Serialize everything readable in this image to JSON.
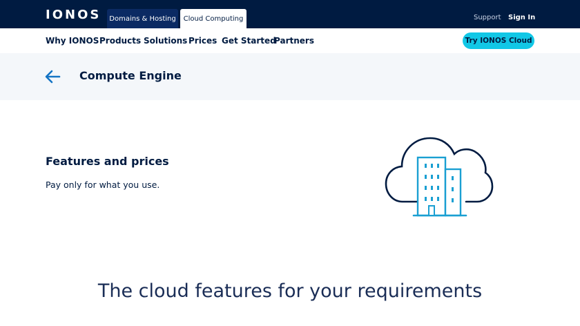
{
  "brand": {
    "logo": "IONOS"
  },
  "top_tabs": {
    "domains": "Domains & Hosting",
    "cloud": "Cloud Computing"
  },
  "top_links": {
    "support": "Support",
    "sign_in": "Sign In"
  },
  "nav": {
    "items": [
      "Why IONOS",
      "Products",
      "Solutions",
      "Prices",
      "Get Started",
      "Partners"
    ],
    "cta": "Try IONOS Cloud"
  },
  "subheader": {
    "title": "Compute Engine",
    "back_icon": "arrow-left-icon"
  },
  "features": {
    "title": "Features and prices",
    "subtitle": "Pay only for what you use.",
    "illustration": "cloud-building-icon"
  },
  "section": {
    "heading": "The cloud features for your requirements"
  },
  "colors": {
    "navy": "#001b41",
    "accent": "#11c7e6",
    "blue": "#1474c4",
    "light_bg": "#f4f7fa"
  }
}
